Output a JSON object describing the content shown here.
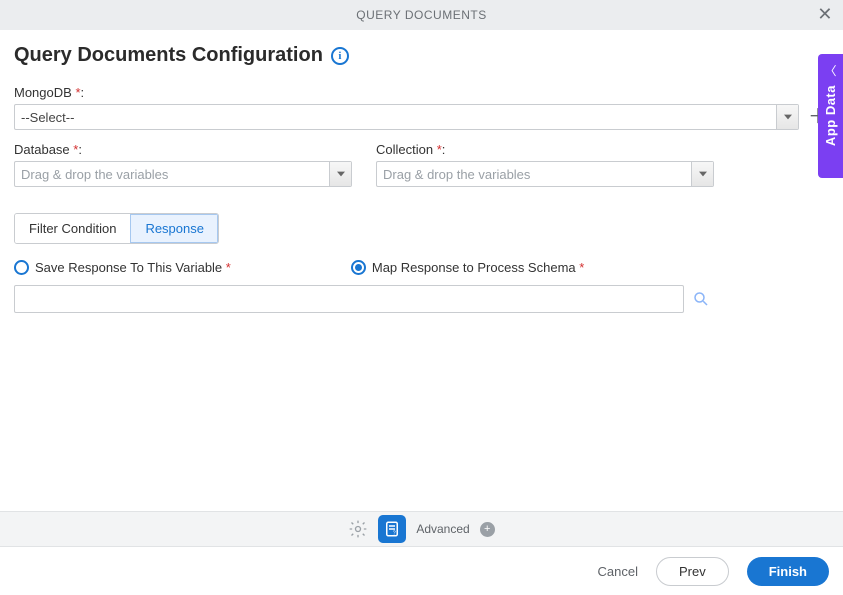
{
  "header": {
    "title": "QUERY DOCUMENTS"
  },
  "page": {
    "title": "Query Documents Configuration"
  },
  "fields": {
    "mongodb": {
      "label": "MongoDB",
      "value": "--Select--"
    },
    "database": {
      "label": "Database",
      "placeholder": "Drag & drop the variables"
    },
    "collection": {
      "label": "Collection",
      "placeholder": "Drag & drop the variables"
    }
  },
  "tabs": {
    "filter": "Filter Condition",
    "response": "Response"
  },
  "radios": {
    "save": "Save Response To This Variable",
    "map": "Map Response to Process Schema"
  },
  "footer": {
    "advanced": "Advanced"
  },
  "sideTab": {
    "label": "App Data"
  },
  "actions": {
    "cancel": "Cancel",
    "prev": "Prev",
    "finish": "Finish"
  },
  "required_mark": "*",
  "colon": ":"
}
